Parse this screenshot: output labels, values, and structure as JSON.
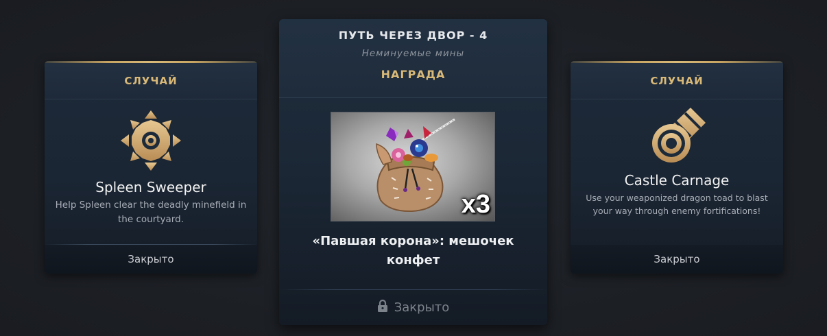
{
  "left_card": {
    "header": "СЛУЧАЙ",
    "icon": "spiked-mine-icon",
    "title": "Spleen Sweeper",
    "description": "Help Spleen clear the deadly minefield in the courtyard.",
    "status": "Закрыто"
  },
  "center_card": {
    "step_title": "ПУТЬ ЧЕРЕЗ ДВОР - 4",
    "subtitle": "Неминуемые мины",
    "reward_label": "НАГРАДА",
    "reward_image": "candy-sack-image",
    "reward_quantity": "x3",
    "reward_name": "«Павшая корона»: мешочек конфет",
    "lock_icon": "lock-icon",
    "status": "Закрыто"
  },
  "right_card": {
    "header": "СЛУЧАЙ",
    "icon": "cannon-icon",
    "title": "Castle Carnage",
    "description": "Use your weaponized dragon toad to blast your way through enemy fortifications!",
    "status": "Закрыто"
  },
  "colors": {
    "gold_accent": "#d9b978",
    "card_bg": "#1b2634",
    "page_bg": "#1e2126",
    "muted_text": "#a7adb6"
  }
}
